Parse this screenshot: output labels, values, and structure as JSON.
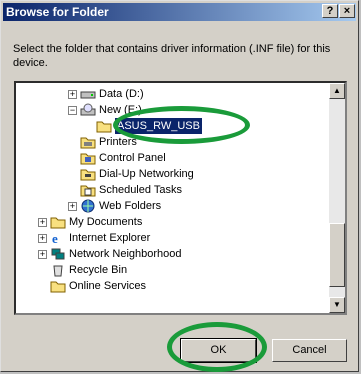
{
  "window": {
    "title": "Browse for Folder",
    "help_glyph": "?",
    "close_glyph": "×"
  },
  "description": "Select the folder that contains driver information (.INF file) for this device.",
  "tree": {
    "items": [
      {
        "label": "Data (D:)",
        "icon": "drive-icon",
        "expander": "+"
      },
      {
        "label": "New (E:)",
        "icon": "cd-drive-icon",
        "expander": "−"
      },
      {
        "label": "ASUS_RW_USB",
        "icon": "folder-icon",
        "selected": true
      },
      {
        "label": "Printers",
        "icon": "printer-icon"
      },
      {
        "label": "Control Panel",
        "icon": "control-panel-icon"
      },
      {
        "label": "Dial-Up Networking",
        "icon": "dialup-icon"
      },
      {
        "label": "Scheduled Tasks",
        "icon": "tasks-icon"
      },
      {
        "label": "Web Folders",
        "icon": "web-folder-icon",
        "expander": "+"
      },
      {
        "label": "My Documents",
        "icon": "documents-icon",
        "expander": "+"
      },
      {
        "label": "Internet Explorer",
        "icon": "ie-icon",
        "expander": "+"
      },
      {
        "label": "Network Neighborhood",
        "icon": "network-icon",
        "expander": "+"
      },
      {
        "label": "Recycle Bin",
        "icon": "recycle-icon"
      },
      {
        "label": "Online Services",
        "icon": "folder-icon"
      }
    ]
  },
  "buttons": {
    "ok": "OK",
    "cancel": "Cancel"
  },
  "colors": {
    "highlight_ring": "#1a9b3a",
    "titlebar": "#0a246a"
  }
}
